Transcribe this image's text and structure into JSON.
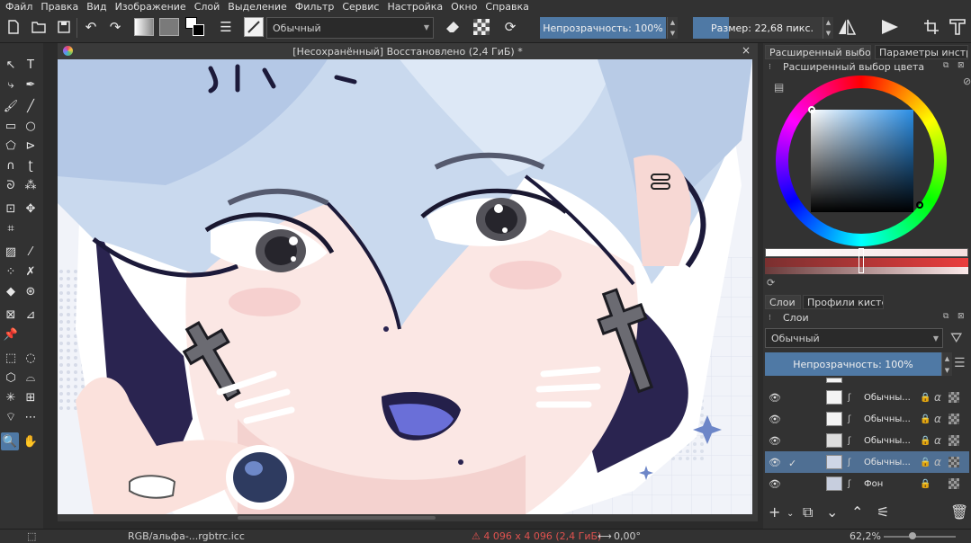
{
  "menu": [
    "Файл",
    "Правка",
    "Вид",
    "Изображение",
    "Слой",
    "Выделение",
    "Фильтр",
    "Сервис",
    "Настройка",
    "Окно",
    "Справка"
  ],
  "toolbar": {
    "brush_preset": "Обычный",
    "opacity_label": "Непрозрачность: 100%",
    "size_label": "Размер: 22,68 пикс."
  },
  "document": {
    "title": "[Несохранённый]  Восстановлено (2,4 ГиБ) *",
    "close": "×"
  },
  "status": {
    "color_model": "RGB/альфа-...rgbtrc.icc",
    "dimensions": "⚠ 4 096 x 4 096 (2,4 ГиБ)",
    "rotation": "0,00°",
    "zoom": "62,2%",
    "warning_color": "#e0524f"
  },
  "right_dock": {
    "tabs_top": [
      "Расширенный выбор...",
      "Параметры инстру..."
    ],
    "color_panel_title": "Расширенный выбор цвета",
    "tabs_layers": [
      "Слои",
      "Профили кистей"
    ],
    "layers_panel_title": "Слои",
    "blend_mode": "Обычный",
    "layer_opacity": "Непрозрачность:  100%",
    "layers": [
      {
        "name": "Обычны...",
        "visible": true,
        "selected": false
      },
      {
        "name": "Обычны...",
        "visible": true,
        "selected": false
      },
      {
        "name": "Обычны...",
        "visible": true,
        "selected": false
      },
      {
        "name": "Обычны...",
        "visible": true,
        "selected": true
      },
      {
        "name": "Фон",
        "visible": true,
        "selected": false
      }
    ]
  },
  "colors": {
    "accent": "#4f79a5",
    "panel": "#323232",
    "selected_layer": "#4f6f93"
  }
}
